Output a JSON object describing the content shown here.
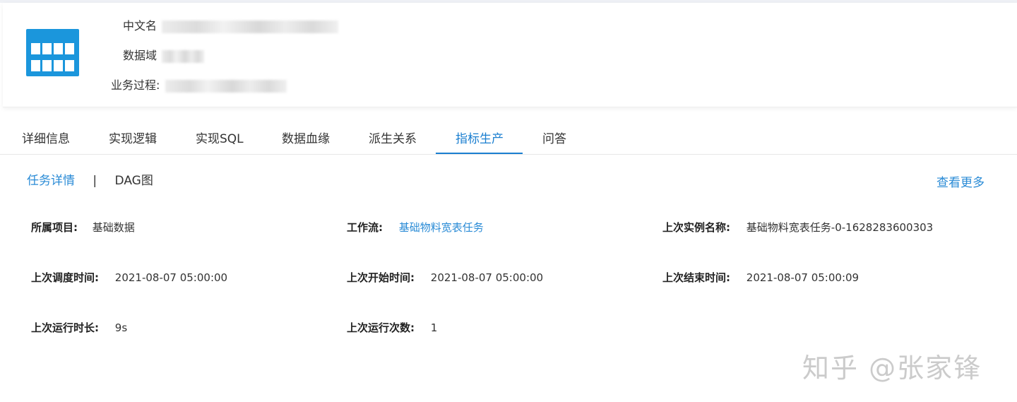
{
  "header": {
    "fields": [
      {
        "label": "中文名"
      },
      {
        "label": "数据域"
      },
      {
        "label": "业务过程:"
      }
    ]
  },
  "tabs": [
    {
      "label": "详细信息"
    },
    {
      "label": "实现逻辑"
    },
    {
      "label": "实现SQL"
    },
    {
      "label": "数据血缘"
    },
    {
      "label": "派生关系"
    },
    {
      "label": "指标生产",
      "active": true
    },
    {
      "label": "问答"
    }
  ],
  "subtabs": {
    "task_detail": "任务详情",
    "separator": "|",
    "dag": "DAG图",
    "more": "查看更多"
  },
  "details": {
    "project": {
      "label": "所属项目:",
      "value": "基础数据"
    },
    "workflow": {
      "label": "工作流:",
      "value": "基础物料宽表任务"
    },
    "last_instance_name": {
      "label": "上次实例名称:",
      "value": "基础物料宽表任务-0-1628283600303"
    },
    "last_schedule_time": {
      "label": "上次调度时间:",
      "value": "2021-08-07 05:00:00"
    },
    "last_start_time": {
      "label": "上次开始时间:",
      "value": "2021-08-07 05:00:00"
    },
    "last_end_time": {
      "label": "上次结束时间:",
      "value": "2021-08-07 05:00:09"
    },
    "last_duration": {
      "label": "上次运行时长:",
      "value": "9s"
    },
    "last_run_count": {
      "label": "上次运行次数:",
      "value": "1"
    }
  },
  "watermark": "知乎 @张家锋",
  "colors": {
    "accent": "#1b7fd0",
    "link": "#2a8bd6",
    "icon": "#1b96dc"
  }
}
